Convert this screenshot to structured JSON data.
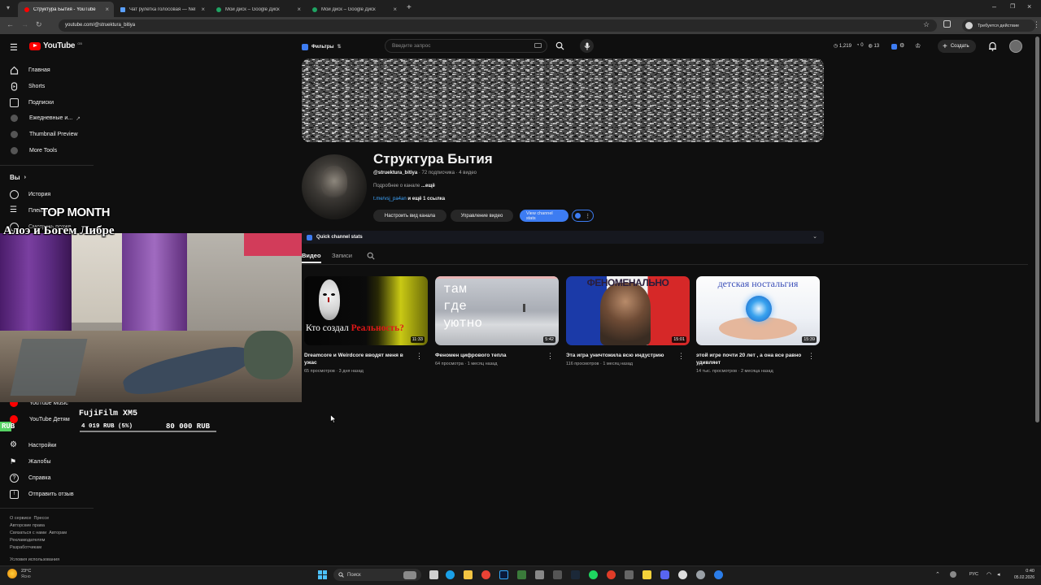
{
  "browser": {
    "tabs": [
      {
        "label": "Структура Бытия - YouTube",
        "active": true
      },
      {
        "label": "Чат рулетка голосовая — Nel",
        "active": false
      },
      {
        "label": "Мой диск – Google Диск",
        "active": false
      },
      {
        "label": "Мой диск – Google Диск",
        "active": false
      }
    ],
    "new_tab": "+",
    "url": "youtube.com/@struektura_bitiya",
    "action_required": "Требуется действие"
  },
  "header": {
    "logo_text": "YouTube",
    "logo_sup": "GB",
    "filters_label": "Фильтры",
    "search_placeholder": "Введите запрос",
    "stats": {
      "views": "1,219",
      "likes": "0",
      "comments": "13"
    },
    "create_label": "Создать"
  },
  "sidebar": {
    "main": [
      {
        "label": "Главная",
        "icon": "home-icon"
      },
      {
        "label": "Shorts",
        "icon": "shorts-icon"
      },
      {
        "label": "Подписки",
        "icon": "subscriptions-icon"
      },
      {
        "label": "Ежедневные и...",
        "icon": "extension-icon"
      },
      {
        "label": "Thumbnail Preview",
        "icon": "extension-icon"
      },
      {
        "label": "More Tools",
        "icon": "extension-icon"
      }
    ],
    "you_label": "Вы",
    "you_items": [
      {
        "label": "История",
        "icon": "history-icon"
      },
      {
        "label": "Плейлисты",
        "icon": "playlist-icon"
      }
    ],
    "partial_label": "Смотреть позже",
    "more_items": [
      {
        "label": "YouTube Music",
        "icon": "yt-music-icon"
      },
      {
        "label": "YouTube Детям",
        "icon": "yt-kids-icon"
      }
    ],
    "settings_items": [
      {
        "label": "Настройки",
        "icon": "gear-icon"
      },
      {
        "label": "Жалобы",
        "icon": "flag-icon"
      },
      {
        "label": "Справка",
        "icon": "help-icon"
      },
      {
        "label": "Отправить отзыв",
        "icon": "feedback-icon"
      }
    ],
    "footer": {
      "line1a": "О сервисе",
      "line1b": "Прессе",
      "line2": "Авторские права",
      "line3a": "Связаться с нами",
      "line3b": "Авторам",
      "line4": "Рекламодателям",
      "line5": "Разработчикам",
      "line6": "Условия использования"
    }
  },
  "channel": {
    "name": "Структура Бытия",
    "handle": "@struektura_bitiya",
    "subscribers": "72 подписчика",
    "videos_count": "4 видео",
    "about": "Подробнее о канале",
    "more": "...ещё",
    "link": "t.me/vsj_pa4an",
    "link_more": "и ещё 1 ссылка",
    "btn_customize": "Настроить вид канала",
    "btn_manage": "Управление видео",
    "btn_stats": "View channel stats",
    "quick_stats": "Quick channel stats",
    "tabs": [
      "Видео",
      "Записи"
    ]
  },
  "videos": [
    {
      "title": "Dreamcore и Weirdcore вводят меня в ужас",
      "views": "65 просмотров",
      "age": "3 дня назад",
      "duration": "11:33",
      "thumb_text1": "Кто создал",
      "thumb_text2": "Реальность?"
    },
    {
      "title": "Феномен цифрового тепла",
      "views": "64 просмотра",
      "age": "1 месяц назад",
      "duration": "5:42",
      "thumb_text1": "там",
      "thumb_text2": "где",
      "thumb_text3": "уютно"
    },
    {
      "title": "Эта игра уничтожила всю индустрию",
      "views": "116 просмотров",
      "age": "1 месяц назад",
      "duration": "15:01",
      "thumb_text1": "ФЕНОМЕНАЛЬНО"
    },
    {
      "title": "этой игре почти 20 лет , а она все равно удивляет",
      "views": "14 тыс. просмотров",
      "age": "2 месяца назад",
      "duration": "15:39",
      "thumb_text1": "детская ностальгия"
    }
  ],
  "overlay": {
    "top_month": "TOP MONTH",
    "donor": "Алоэ и Богем Либре",
    "goal_title": "FujiFilm XM5",
    "currency_left": "RUB",
    "goal_current": "4 019 RUB (5%)",
    "goal_target": "80 000 RUB",
    "goal_progress": 0.05
  },
  "taskbar": {
    "weather_temp": "23°C",
    "weather_desc": "Ясно",
    "search": "Поиск",
    "lang": "РУС",
    "time": "0:40",
    "date": "05.02.2026"
  },
  "colors": {
    "accent_blue": "#3ea6ff",
    "yt_red": "#ff0000",
    "stats_button": "#3d7cf2"
  }
}
